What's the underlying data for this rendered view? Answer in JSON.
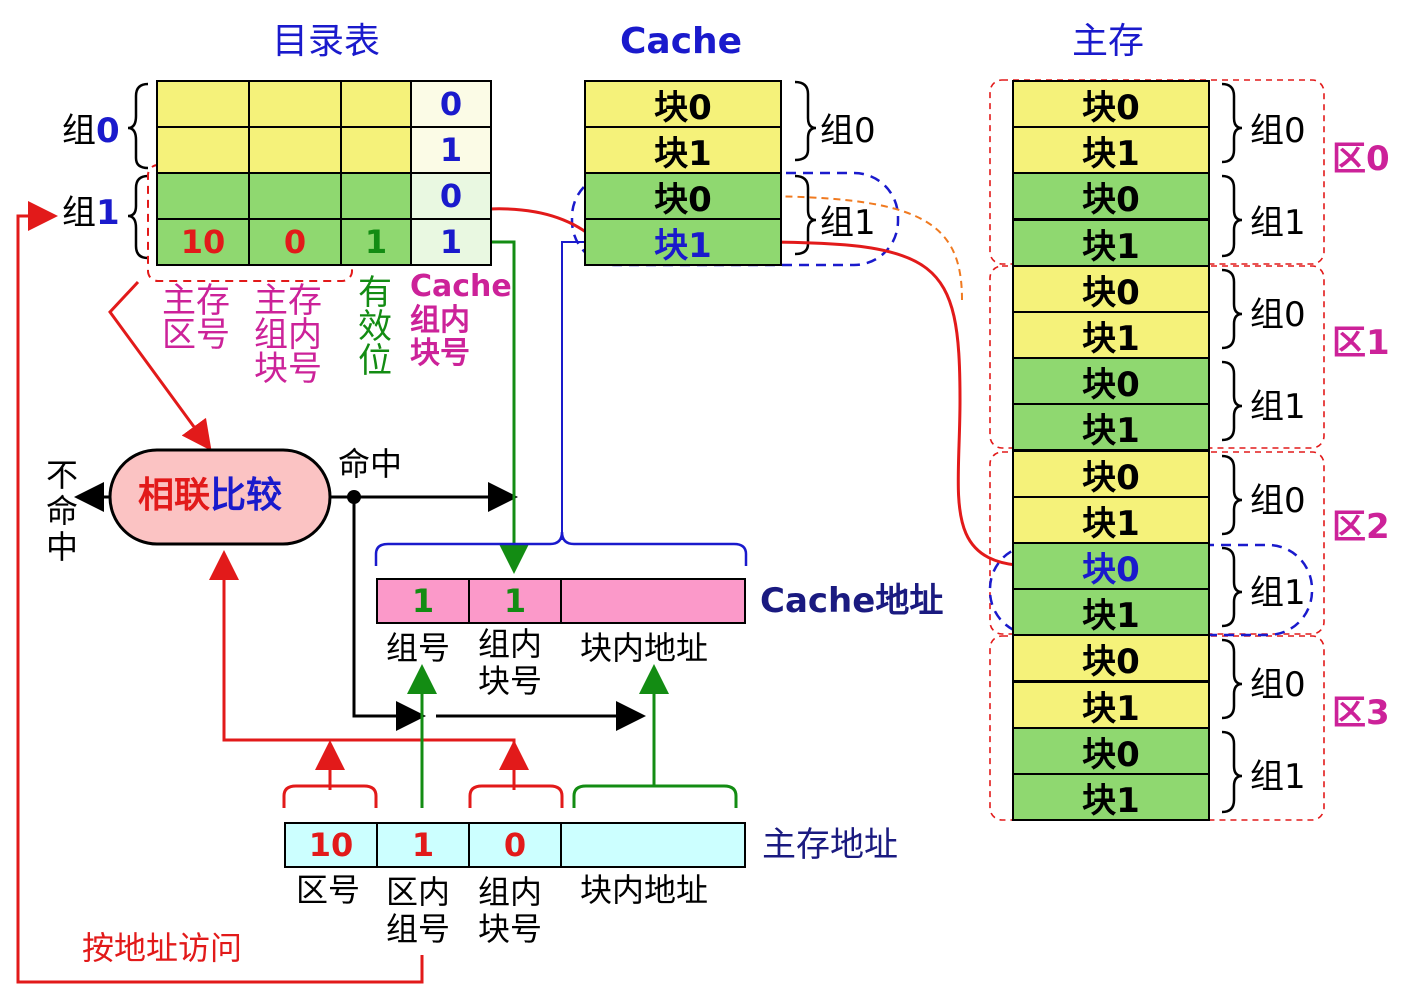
{
  "titles": {
    "directory": "目录表",
    "cache": "Cache",
    "main_memory": "主存"
  },
  "directory": {
    "group0_label": "组",
    "group0_num": "0",
    "group1_label": "组",
    "group1_num": "1",
    "rows": [
      {
        "col4": "0"
      },
      {
        "col4": "1"
      },
      {
        "col4": "0"
      },
      {
        "col1": "10",
        "col2": "0",
        "col3": "1",
        "col4": "1"
      }
    ],
    "col_labels": {
      "zone": "主存\n区号",
      "inblock": "主存\n组内\n块号",
      "valid": "有\n效\n位",
      "cache_block": "Cache\n组内\n块号"
    }
  },
  "cache": {
    "blocks": [
      {
        "text": "块0"
      },
      {
        "text": "块1"
      },
      {
        "text": "块0"
      },
      {
        "text": "块1"
      }
    ],
    "group_labels": [
      "组0",
      "组1"
    ]
  },
  "memory": {
    "blocks": [
      "块0",
      "块1",
      "块0",
      "块1",
      "块0",
      "块1",
      "块0",
      "块1",
      "块0",
      "块1",
      "块0",
      "块1",
      "块0",
      "块1",
      "块0",
      "块1"
    ],
    "group_labels": [
      "组0",
      "组1",
      "组0",
      "组1",
      "组0",
      "组1",
      "组0",
      "组1"
    ],
    "zone_labels": [
      "区0",
      "区1",
      "区2",
      "区3"
    ]
  },
  "compare": {
    "label_part1": "相联",
    "label_part2": "比较",
    "hit": "命中",
    "miss": "不\n命\n中"
  },
  "cache_address": {
    "title": "Cache地址",
    "fields": [
      "1",
      "1",
      ""
    ],
    "labels": [
      "组号",
      "组内\n块号",
      "块内地址"
    ]
  },
  "main_address": {
    "title": "主存地址",
    "fields": [
      "10",
      "1",
      "0",
      ""
    ],
    "labels": [
      "区号",
      "区内\n组号",
      "组内\n块号",
      "块内地址"
    ]
  },
  "access_label": "按地址访问"
}
